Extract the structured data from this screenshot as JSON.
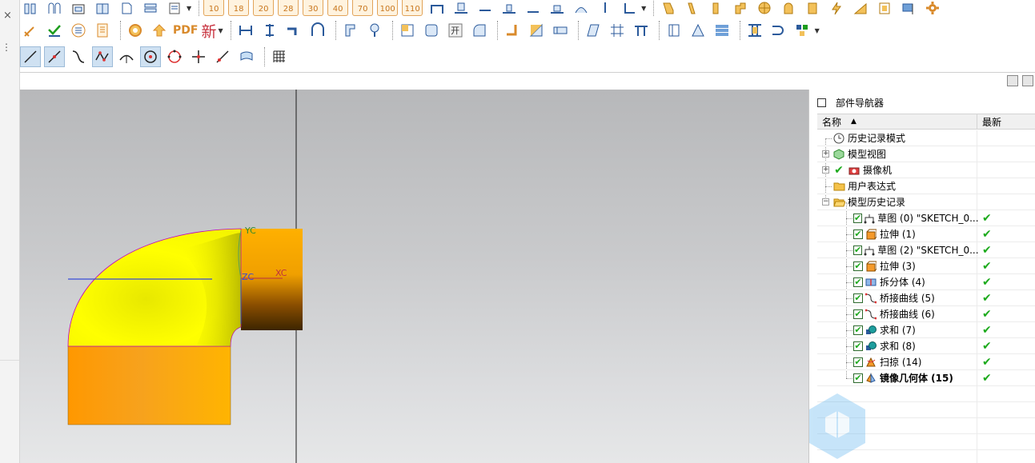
{
  "left_strip": {
    "close_glyph": "×",
    "more_glyph": "⋮"
  },
  "toolbar_top": {
    "layer_numbers": [
      "10",
      "18",
      "20",
      "28",
      "30",
      "40",
      "70",
      "100",
      "110"
    ]
  },
  "toolbar_middle": {
    "pdf_label": "PDF",
    "new_label": "新",
    "window_label": "开"
  },
  "viewport": {
    "axis_yc": "YC",
    "axis_zc": "ZC",
    "axis_xc": "XC",
    "colors": {
      "yellow": "#ffff00",
      "orange": "#ffa500"
    }
  },
  "navigator": {
    "title": "部件导航器",
    "col_name": "名称",
    "col_latest": "最新",
    "rows": [
      {
        "label": "历史记录模式",
        "icon": "clock-icon",
        "latest": ""
      },
      {
        "label": "模型视图",
        "icon": "model-view-icon",
        "latest": ""
      },
      {
        "label": "摄像机",
        "icon": "camera-icon",
        "latest": ""
      },
      {
        "label": "用户表达式",
        "icon": "folder-icon",
        "latest": ""
      },
      {
        "label": "模型历史记录",
        "icon": "folder-open-icon",
        "latest": ""
      },
      {
        "label": "草图 (0) \"SKETCH_0...",
        "icon": "sketch-icon",
        "latest": "✔"
      },
      {
        "label": "拉伸 (1)",
        "icon": "extrude-icon",
        "latest": "✔"
      },
      {
        "label": "草图 (2) \"SKETCH_0...",
        "icon": "sketch-icon",
        "latest": "✔"
      },
      {
        "label": "拉伸 (3)",
        "icon": "extrude-icon",
        "latest": "✔"
      },
      {
        "label": "拆分体 (4)",
        "icon": "split-body-icon",
        "latest": "✔"
      },
      {
        "label": "桥接曲线 (5)",
        "icon": "bridge-curve-icon",
        "latest": "✔"
      },
      {
        "label": "桥接曲线 (6)",
        "icon": "bridge-curve-icon",
        "latest": "✔"
      },
      {
        "label": "求和 (7)",
        "icon": "unite-icon",
        "latest": "✔"
      },
      {
        "label": "求和 (8)",
        "icon": "unite-icon",
        "latest": "✔"
      },
      {
        "label": "扫掠 (14)",
        "icon": "sweep-icon",
        "latest": "✔"
      },
      {
        "label": "镜像几何体 (15)",
        "icon": "mirror-geometry-icon",
        "latest": "✔"
      }
    ]
  }
}
